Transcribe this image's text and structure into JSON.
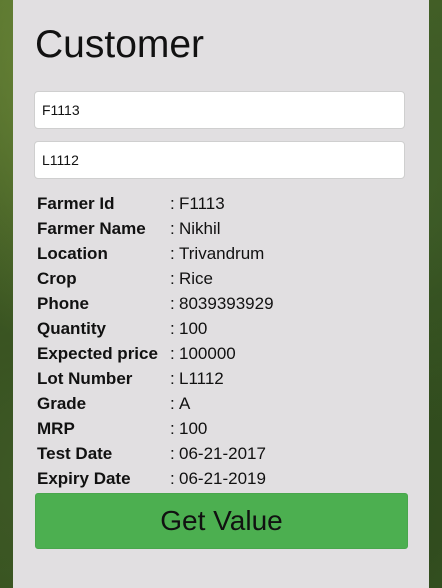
{
  "title": "Customer",
  "inputs": {
    "farmer_id_value": "F1113",
    "lot_number_value": "L1112"
  },
  "details": [
    {
      "label": "Farmer Id",
      "sep": ":",
      "value": "F1113"
    },
    {
      "label": "Farmer Name",
      "sep": ":",
      "value": "Nikhil"
    },
    {
      "label": "Location",
      "sep": ":",
      "value": "Trivandrum"
    },
    {
      "label": "Crop",
      "sep": ":",
      "value": "Rice"
    },
    {
      "label": "Phone",
      "sep": ":",
      "value": "8039393929"
    },
    {
      "label": "Quantity",
      "sep": ":",
      "value": "100"
    },
    {
      "label": "Expected price",
      "sep": ":",
      "value": "100000"
    },
    {
      "label": "Lot Number",
      "sep": ":",
      "value": "L1112"
    },
    {
      "label": "Grade",
      "sep": ":",
      "value": "A"
    },
    {
      "label": "MRP",
      "sep": ":",
      "value": "100"
    },
    {
      "label": "Test Date",
      "sep": ":",
      "value": "06-21-2017"
    },
    {
      "label": "Expiry Date",
      "sep": ":",
      "value": "06-21-2019"
    }
  ],
  "button": {
    "label": "Get Value",
    "color": "#4caf50"
  },
  "colors": {
    "card_background": "#e1dfe1"
  }
}
